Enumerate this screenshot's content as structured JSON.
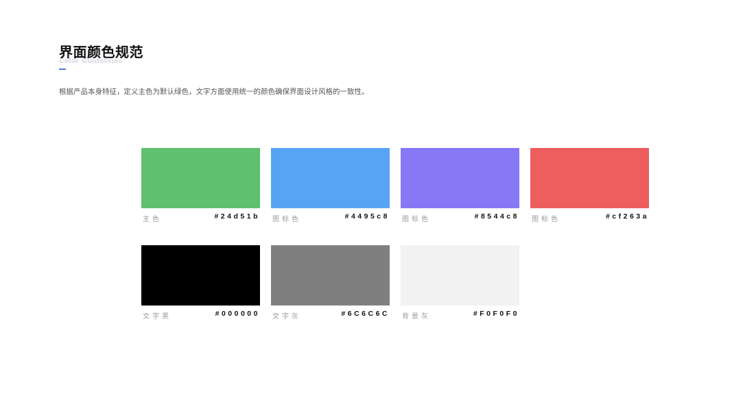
{
  "header": {
    "title": "界面颜色规范",
    "subtitle": "Color Guidelines",
    "description": "根据产品本身特征，定义主色为默认绿色，文字方面使用统一的颜色确保界面设计风格的一致性。"
  },
  "colors": [
    {
      "name": "主色",
      "hex_label": "#24d51b",
      "swatch": "#5FC06D"
    },
    {
      "name": "图标色",
      "hex_label": "#4495c8",
      "swatch": "#57A4F5"
    },
    {
      "name": "图标色",
      "hex_label": "#8544c8",
      "swatch": "#8878F6"
    },
    {
      "name": "图标色",
      "hex_label": "#cf263a",
      "swatch": "#EC5F5E"
    },
    {
      "name": "文字黑",
      "hex_label": "#000000",
      "swatch": "#000000"
    },
    {
      "name": "文字灰",
      "hex_label": "#6C6C6C",
      "swatch": "#7F7F7F"
    },
    {
      "name": "背景灰",
      "hex_label": "#F0F0F0",
      "swatch": "#F2F2F2"
    }
  ],
  "theme": {
    "accent": "#4A7BD9"
  }
}
